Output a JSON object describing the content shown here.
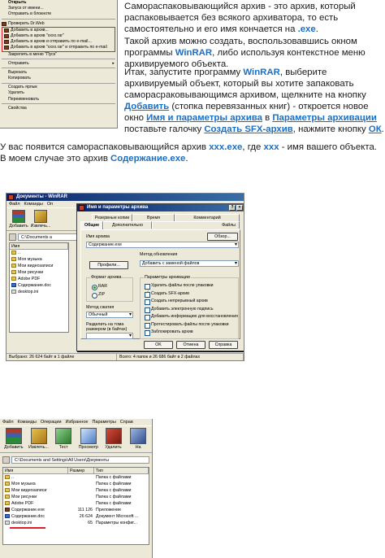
{
  "context_menu": {
    "items": [
      {
        "label": "Открыть",
        "bold": true
      },
      {
        "label": "Запуск от имени..."
      },
      {
        "label": "Отправить в блокноте"
      },
      {
        "sep": true
      },
      {
        "label": "Проверить Dr.Web",
        "icon": true
      }
    ],
    "winrar_items": [
      "Добавить в архив...",
      "Добавить в архив \"xxxx.rar\"",
      "Добавить в архив и отправить по e-mail...",
      "Добавить в архив \"xxxx.rar\" и отправить по e-mail"
    ],
    "items_after": [
      {
        "label": "Закрепить в меню \"Пуск\""
      },
      {
        "sep": true
      },
      {
        "label": "Отправить",
        "submenu": true
      },
      {
        "sep": true
      },
      {
        "label": "Вырезать"
      },
      {
        "label": "Копировать"
      },
      {
        "sep": true
      },
      {
        "label": "Создать ярлык"
      },
      {
        "label": "Удалить"
      },
      {
        "label": "Переименовать"
      },
      {
        "sep": true
      },
      {
        "label": "Свойства"
      }
    ]
  },
  "article": {
    "p1": {
      "text_a": "Самораспаковывающийся архив - это архив, который распаковывается без всякого архиватора, то есть самостоятельно и его имя кончается на ",
      "ext": ".exe",
      "text_b": "."
    },
    "p2": {
      "text_a": "Такой архив можно создать, воспользовавшись окном программы ",
      "prog": "WinRAR",
      "text_b": ", либо используя контекстное меню архивируемого объекта."
    },
    "p3": {
      "t1": "Итак, запустите программу ",
      "prog": "WinRAR",
      "t2": ", выберите архивируемый объект, который вы хотите запаковать саморасраковывающимся архивом, щелкните на кнопку ",
      "add": "Добавить",
      "t3": " (стопка перевязанных книг) - откроется новое окно ",
      "win_name": "Имя и параметры архива",
      "t4": " в ",
      "tab_name": "Параметры архивации",
      "t5": " поставьте галочку ",
      "opt": "Создать SFX-архив",
      "t6": ", нажмите кнопку ",
      "ok": "ОК",
      "t7": "."
    },
    "p4": {
      "t1": "У вас появится самораспаковывающийся архив ",
      "f1": "xxx.exe",
      "t2": ", где ",
      "f2": "xxx",
      "t3": " - имя вашего объекта. В моем случае это архив ",
      "f3": "Содержание.exe",
      "t4": "."
    }
  },
  "win1": {
    "title": "Документы - WinRAR",
    "menu": [
      "Файл",
      "Команды",
      "Оп"
    ],
    "toolbar": [
      "Добавить",
      "Извлечь..."
    ],
    "address": "C:\\Documents a",
    "col_name": "Имя",
    "files": [
      {
        "name": "..",
        "type": "folder"
      },
      {
        "name": "Моя музыка",
        "type": "folder"
      },
      {
        "name": "Мои видеозаписи",
        "type": "folder"
      },
      {
        "name": "Мои рисунки",
        "type": "folder"
      },
      {
        "name": "Adobe PDF",
        "type": "folder"
      },
      {
        "name": "Содержание.doc",
        "type": "doc"
      },
      {
        "name": "desktop.ini",
        "type": "ini"
      }
    ],
    "status_left": "Выбрано: 26 624 байт в 1 файле",
    "status_right": "Всего: 4 папок и 26 686 байт в 2 файлах"
  },
  "dialog": {
    "title": "Имя и параметры архива",
    "tabs_row1": [
      "Резервные копии",
      "Время",
      "Комментарий"
    ],
    "tabs_row2": [
      "Общие",
      "Дополнительно",
      "Файлы"
    ],
    "archive_name_label": "Имя архива",
    "browse_button": "Обзор...",
    "archive_name_value": "Содержание.exe",
    "profiles_button": "Профили...",
    "update_method_label": "Метод обновления",
    "update_method_value": "Добавить с заменой файлов",
    "format_group": "Формат архива",
    "format_rar": "RAR",
    "format_zip": "ZIP",
    "compression_label": "Метод сжатия",
    "compression_value": "Обычный",
    "split_label": "Разделить на тома размером (в байтах)",
    "options_group": "Параметры архивации",
    "options": [
      {
        "label": "Удалить файлы после упаковки",
        "checked": false
      },
      {
        "label": "Создать SFX-архив",
        "checked": true
      },
      {
        "label": "Создать непрерывный архив",
        "checked": false
      },
      {
        "label": "Добавить электронную подпись",
        "checked": false
      },
      {
        "label": "Добавить информацию для восстановления",
        "checked": false
      },
      {
        "label": "Протестировать файлы после упаковки",
        "checked": false
      },
      {
        "label": "Заблокировать архив",
        "checked": false
      }
    ],
    "ok_button": "OK",
    "cancel_button": "Отмена",
    "help_button": "Справка"
  },
  "win2": {
    "menu": [
      "Файл",
      "Команды",
      "Операции",
      "Избранное",
      "Параметры",
      "Справ"
    ],
    "toolbar": [
      "Добавить",
      "Извлечь...",
      "Тест",
      "Просмотр",
      "Удалить",
      "На"
    ],
    "address": "C:\\Documents and Settings\\All Users\\Документы",
    "columns": [
      "Имя",
      "Размер",
      "Тип"
    ],
    "files": [
      {
        "name": "..",
        "size": "",
        "type_text": "Папка с файлами",
        "icon": "folder"
      },
      {
        "name": "Моя музыка",
        "size": "",
        "type_text": "Папка с файлами",
        "icon": "folder"
      },
      {
        "name": "Мои видеозаписи",
        "size": "",
        "type_text": "Папка с файлами",
        "icon": "folder"
      },
      {
        "name": "Мои рисунки",
        "size": "",
        "type_text": "Папка с файлами",
        "icon": "folder"
      },
      {
        "name": "Adobe PDF",
        "size": "",
        "type_text": "Папка с файлами",
        "icon": "folder"
      },
      {
        "name": "Содержание.exe",
        "size": "111 126",
        "type_text": "Приложение",
        "icon": "exe"
      },
      {
        "name": "Содержание.doc",
        "size": "26 624",
        "type_text": "Документ Microsoft ...",
        "icon": "doc"
      },
      {
        "name": "desktop.ini",
        "size": "65",
        "type_text": "Параметры конфиг...",
        "icon": "ini"
      }
    ]
  },
  "colors": {
    "accent_link": "#1a6fc4",
    "highlight_red": "#e0202a",
    "title_blue": "#0a246a"
  }
}
